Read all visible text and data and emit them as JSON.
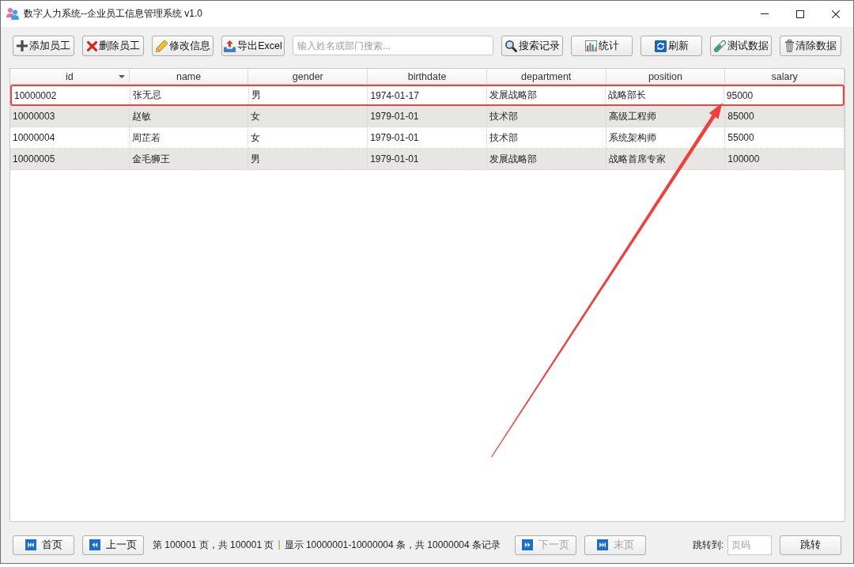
{
  "window": {
    "title": "数字人力系统--企业员工信息管理系统 v1.0"
  },
  "toolbar": {
    "buttons_left": [
      {
        "kind": "add",
        "label": "添加员工"
      },
      {
        "kind": "delete",
        "label": "删除员工"
      },
      {
        "kind": "edit",
        "label": "修改信息"
      },
      {
        "kind": "export",
        "label": "导出Excel"
      }
    ],
    "search": {
      "placeholder": "输入姓名或部门搜索..."
    },
    "buttons_right": [
      {
        "kind": "search",
        "label": "搜索记录"
      },
      {
        "kind": "stats",
        "label": "统计"
      },
      {
        "kind": "refresh",
        "label": "刷新"
      },
      {
        "kind": "test",
        "label": "测试数据"
      },
      {
        "kind": "clear",
        "label": "清除数据"
      }
    ]
  },
  "table": {
    "columns": [
      {
        "label": "id",
        "sorted": true
      },
      {
        "label": "name",
        "sorted": false
      },
      {
        "label": "gender",
        "sorted": false
      },
      {
        "label": "birthdate",
        "sorted": false
      },
      {
        "label": "department",
        "sorted": false
      },
      {
        "label": "position",
        "sorted": false
      },
      {
        "label": "salary",
        "sorted": false
      }
    ],
    "rows": [
      {
        "cells": [
          "10000002",
          "张无忌",
          "男",
          "1974-01-17",
          "发展战略部",
          "战略部长",
          "95000"
        ],
        "highlighted": true
      },
      {
        "cells": [
          "10000003",
          "赵敏",
          "女",
          "1979-01-01",
          "技术部",
          "高级工程师",
          "85000"
        ],
        "highlighted": false
      },
      {
        "cells": [
          "10000004",
          "周芷若",
          "女",
          "1979-01-01",
          "技术部",
          "系统架构师",
          "55000"
        ],
        "highlighted": false
      },
      {
        "cells": [
          "10000005",
          "金毛狮王",
          "男",
          "1979-01-01",
          "发展战略部",
          "战略首席专家",
          "100000"
        ],
        "highlighted": false
      }
    ]
  },
  "pagination": {
    "buttons_before": [
      {
        "kind": "first",
        "label": "首页",
        "disabled": false
      },
      {
        "kind": "previous",
        "label": "上一页",
        "disabled": false
      }
    ],
    "page_info": "第 100001 页，共 100001 页",
    "separator": "|",
    "record_info": "显示 10000001-10000004 条，共 10000004 条记录",
    "buttons_after": [
      {
        "kind": "next",
        "label": "下一页",
        "disabled": true
      },
      {
        "kind": "last",
        "label": "末页",
        "disabled": true
      }
    ],
    "jump": {
      "label": "跳转到:",
      "field": {
        "placeholder": "页码"
      },
      "button": "跳转"
    }
  }
}
